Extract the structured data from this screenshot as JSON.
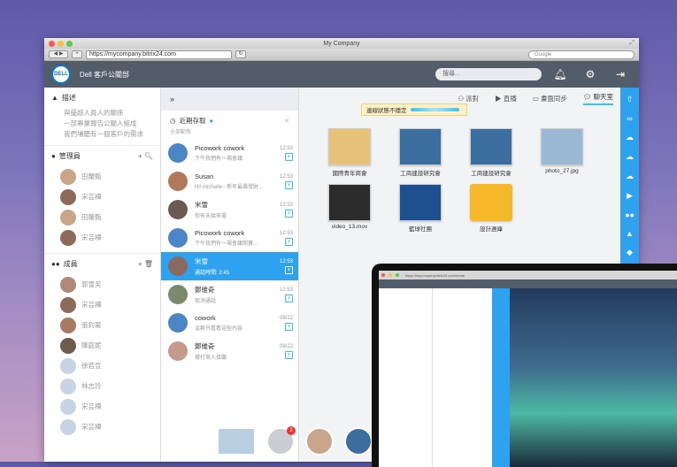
{
  "window": {
    "title": "My Company",
    "url": "https://mycompany.bitrix24.com",
    "search_placeholder": "Google"
  },
  "header": {
    "logo": "DELL",
    "company": "Dell 客戶公關部",
    "search_placeholder": "搜尋..."
  },
  "sidebar": {
    "about_title": "描述",
    "about_text": [
      "與優超人員人的關係",
      "一部專業報告公關人組成",
      "我們埔聽有一個客戶的需求"
    ],
    "admins_title": "管理員",
    "admins": [
      "田蘭甄",
      "宋芸樺",
      "田蘭甄",
      "宋芸樺"
    ],
    "members_title": "成員",
    "members": [
      "郭雪芙",
      "宋芸樺",
      "張鈞甯",
      "陳庭妮",
      "徐若宣",
      "林志玲",
      "宋芸樺",
      "宋芸樺"
    ]
  },
  "chat": {
    "header_title": "近期存取",
    "header_sub": "全部動態",
    "items": [
      {
        "name": "Picowork cowork",
        "msg": "下午我們有一場會議",
        "time": "12:53",
        "color": "#4a86c5"
      },
      {
        "name": "Susan",
        "msg": "Hi! michelle~ 新年最壽發財...",
        "time": "12:53",
        "color": "#b07a5a"
      },
      {
        "name": "米雪",
        "msg": "你有未接來電",
        "time": "12:53",
        "color": "#6b5a52"
      },
      {
        "name": "Picowork cowork",
        "msg": "下午我們有一場會議開寶...",
        "time": "12:53",
        "color": "#4a86c5"
      },
      {
        "name": "米雪",
        "msg": "通話時間: 2:45",
        "time": "12:53",
        "color": "#8a6a60",
        "selected": true
      },
      {
        "name": "鄭維奇",
        "msg": "取消通話",
        "time": "12:53",
        "color": "#7a8a6a"
      },
      {
        "name": "cowork",
        "msg": "這群只看看這些內容",
        "time": "08/22",
        "color": "#4a86c5"
      },
      {
        "name": "鄭維奇",
        "msg": "撥打來人接聽",
        "time": "08/22",
        "color": "#c49a8a"
      }
    ]
  },
  "tabs": [
    "派對",
    "直播",
    "畫面同步",
    "聊天室"
  ],
  "warning": "連線狀態不穩定",
  "files": [
    {
      "name": "國際青年商會",
      "color": "#e7c27b"
    },
    {
      "name": "工商建設研究會",
      "color": "#3c6fa0"
    },
    {
      "name": "工商建設研究會",
      "color": "#3c6fa0"
    },
    {
      "name": "photo_27.jpg",
      "color": "#9ab9d4"
    },
    {
      "name": "video_13.mov",
      "color": "#2c2c2c"
    },
    {
      "name": "籃球社團",
      "color": "#1d4f91"
    },
    {
      "name": "設計週庫",
      "color": "#f5b828"
    }
  ],
  "badge": "2",
  "laptop": {
    "url": "https://mycompany.bitrix24.com/home"
  }
}
